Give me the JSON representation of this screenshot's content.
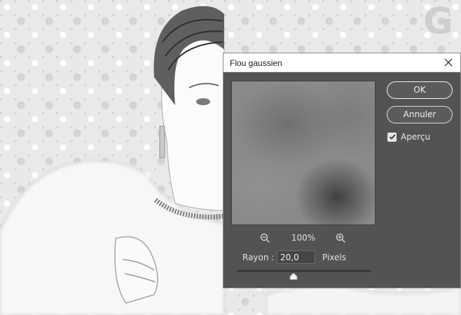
{
  "dialog": {
    "title": "Flou gaussien",
    "close_icon": "close-icon",
    "buttons": {
      "ok_label": "OK",
      "cancel_label": "Annuler"
    },
    "preview_option": {
      "label": "Aperçu",
      "checked": true
    },
    "zoom": {
      "zoom_out_icon": "zoom-out-icon",
      "zoom_in_icon": "zoom-in-icon",
      "level": "100%"
    },
    "radius": {
      "label": "Rayon :",
      "value": "20,0",
      "unit": "Pixels",
      "slider_fraction": 0.43
    }
  },
  "colors": {
    "dialog_bg": "#535353",
    "titlebar_bg": "#ffffff",
    "text_light": "#e0e0e0"
  }
}
